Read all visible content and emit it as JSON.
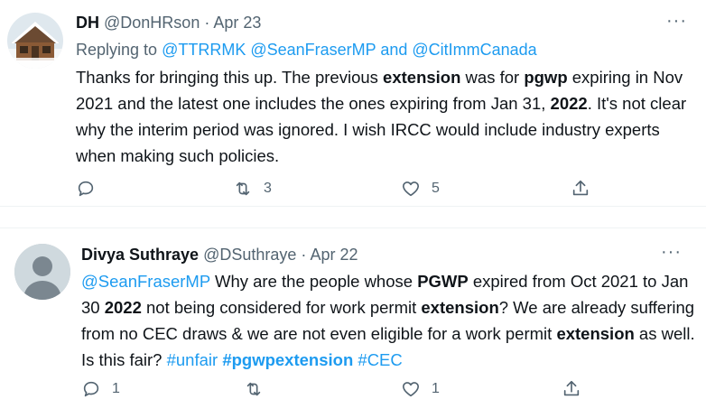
{
  "tweets": [
    {
      "name": "DH",
      "handle": "@DonHRson",
      "separator": "·",
      "date": "Apr 23",
      "replying_prefix": "Replying to",
      "replying_to": "@TTRRMK @SeanFraserMP and @CitImmCanada",
      "text_parts": [
        {
          "t": "Thanks for bringing this up. The previous "
        },
        {
          "t": "extension",
          "b": true
        },
        {
          "t": " was for "
        },
        {
          "t": "pgwp",
          "b": true
        },
        {
          "t": " expiring in Nov 2021 and the latest one includes the ones expiring from Jan 31, "
        },
        {
          "t": "2022",
          "b": true
        },
        {
          "t": ". It's not clear why the interim period was ignored.  I wish IRCC would include industry experts when making such policies."
        }
      ],
      "replies": "",
      "retweets": "3",
      "likes": "5",
      "more": "···"
    },
    {
      "name": "Divya Suthraye",
      "handle": "@DSuthraye",
      "separator": "·",
      "date": "Apr 22",
      "text_parts": [
        {
          "t": "@SeanFraserMP",
          "link": true
        },
        {
          "t": " Why are the people whose "
        },
        {
          "t": "PGWP",
          "b": true
        },
        {
          "t": " expired from Oct 2021 to Jan 30 "
        },
        {
          "t": "2022",
          "b": true
        },
        {
          "t": " not being considered for work permit "
        },
        {
          "t": "extension",
          "b": true
        },
        {
          "t": "? We are already suffering from no CEC draws & we are not even eligible for a work permit "
        },
        {
          "t": "extension",
          "b": true
        },
        {
          "t": " as well. Is this fair? "
        },
        {
          "t": "#unfair",
          "link": true
        },
        {
          "t": " "
        },
        {
          "t": "#pgwpextension",
          "link": true,
          "b": true
        },
        {
          "t": " "
        },
        {
          "t": "#CEC",
          "link": true
        }
      ],
      "replies": "1",
      "retweets": "",
      "likes": "1",
      "more": "···"
    }
  ],
  "icons": [
    "reply-icon",
    "retweet-icon",
    "like-icon",
    "share-icon",
    "more-icon"
  ],
  "colors": {
    "link": "#1d9bf0",
    "muted": "#536471",
    "text": "#0f1419"
  }
}
